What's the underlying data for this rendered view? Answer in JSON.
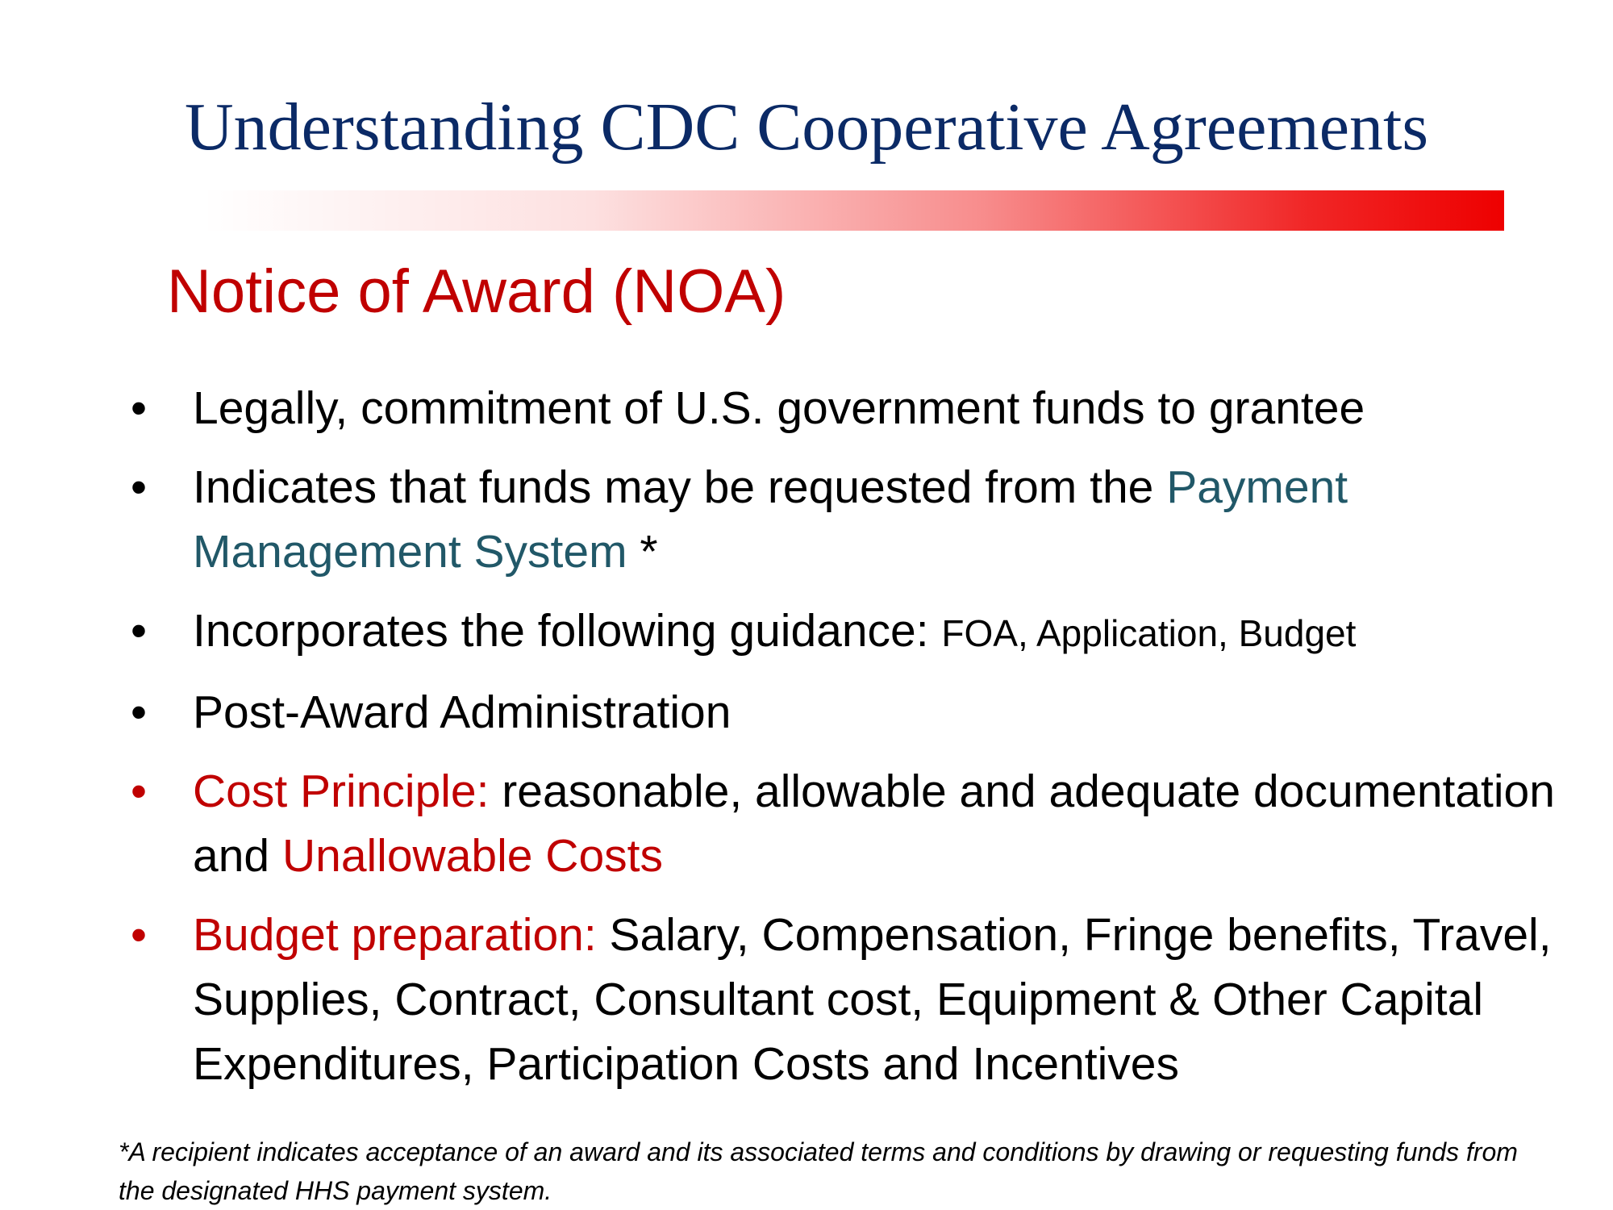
{
  "slide": {
    "title": "Understanding CDC Cooperative Agreements",
    "subtitle": "Notice of Award (NOA)",
    "bullet_marker": "•",
    "bullets": [
      {
        "text": "Legally, commitment of U.S. government funds to grantee"
      },
      {
        "text": "Indicates that funds may be requested from the ",
        "highlight": "Payment Management System",
        "suffix": " *"
      },
      {
        "text": "Incorporates the following guidance: ",
        "detail": "FOA, Application, Budget"
      },
      {
        "text": "Post-Award Administration"
      },
      {
        "label": "Cost Principle:",
        "text": " reasonable, allowable and adequate documentation and ",
        "highlight": "Unallowable Costs"
      },
      {
        "label": "Budget preparation:",
        "text": " Salary, Compensation, Fringe benefits, Travel, Supplies, Contract, Consultant cost, Equipment & Other Capital Expenditures, Participation Costs and Incentives"
      }
    ],
    "footnote": "*A recipient indicates acceptance of an award and its associated terms and conditions by drawing or requesting funds from the designated HHS payment system."
  },
  "colors": {
    "title": "#0b2a66",
    "accent_red": "#c00000",
    "bar_red": "#ee0000",
    "link_teal": "#215868",
    "body_text": "#000000"
  }
}
